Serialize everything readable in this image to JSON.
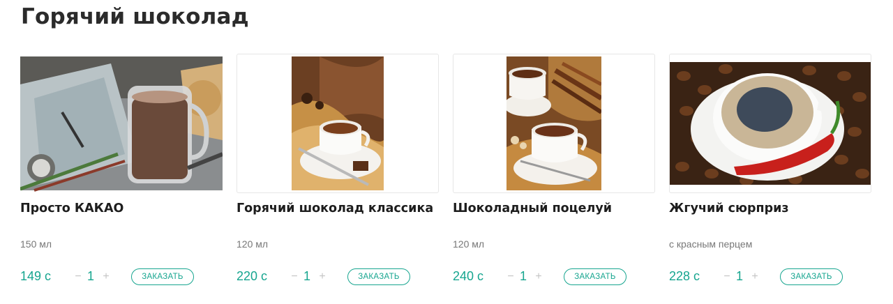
{
  "page": {
    "title": "Горячий шоколад"
  },
  "products": [
    {
      "name": "Просто КАКАО",
      "description": "150 мл",
      "price": "149 с",
      "quantity": "1",
      "order_label": "ЗАКАЗАТЬ",
      "image": "cocoa-glass-photo"
    },
    {
      "name": "Горячий шоколад классика",
      "description": "120 мл",
      "price": "220 с",
      "quantity": "1",
      "order_label": "ЗАКАЗАТЬ",
      "image": "hot-chocolate-cup-photo"
    },
    {
      "name": "Шоколадный поцелуй",
      "description": "120 мл",
      "price": "240 с",
      "quantity": "1",
      "order_label": "ЗАКАЗАТЬ",
      "image": "chocolate-cups-cinnamon-photo"
    },
    {
      "name": "Жгучий сюрприз",
      "description": "с красным перцем",
      "price": "228 с",
      "quantity": "1",
      "order_label": "ЗАКАЗАТЬ",
      "image": "cup-coffee-beans-chili-photo"
    }
  ],
  "controls": {
    "minus_symbol": "−",
    "plus_symbol": "+"
  },
  "colors": {
    "accent": "#16a58f",
    "muted_text": "#777777",
    "title_text": "#2b2b2b"
  }
}
